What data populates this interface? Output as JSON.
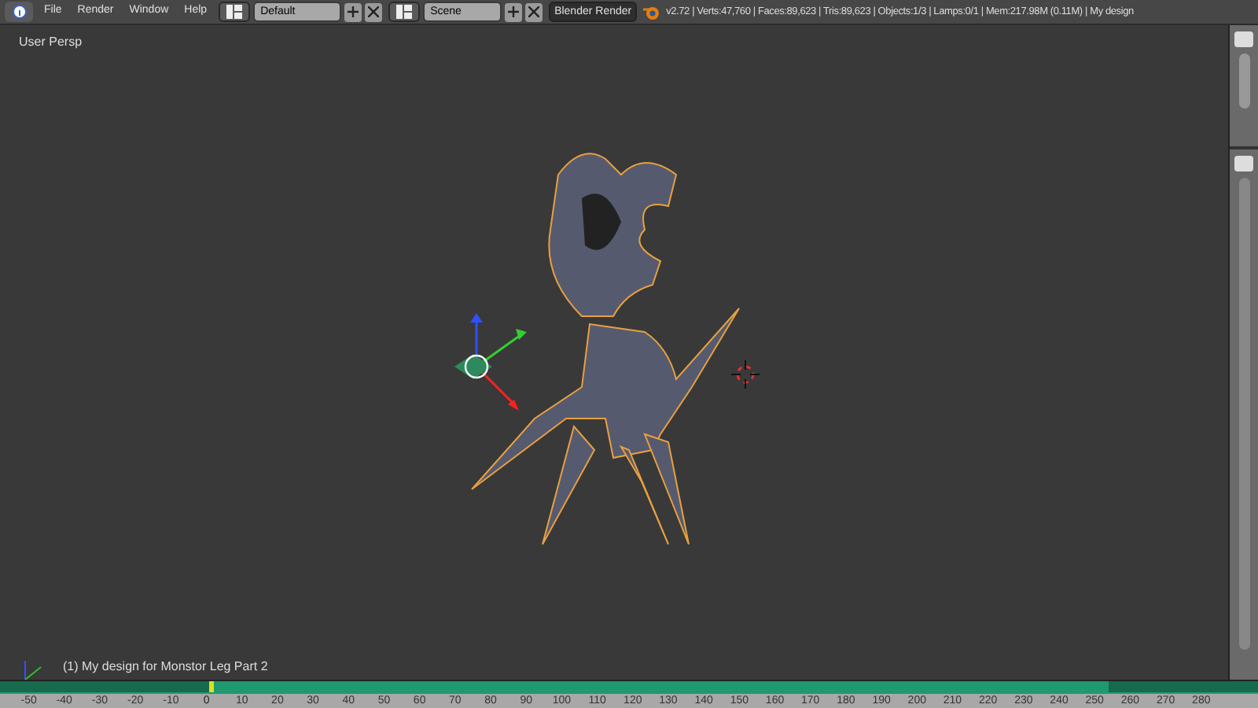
{
  "header": {
    "menus": [
      "File",
      "Render",
      "Window",
      "Help"
    ],
    "layout": "Default",
    "scene": "Scene",
    "engine": "Blender Render",
    "stats": "v2.72 | Verts:47,760 | Faces:89,623 | Tris:89,623 | Objects:1/3 | Lamps:0/1 | Mem:217.98M (0.11M) | My design"
  },
  "viewport": {
    "view_label": "User Persp",
    "object_label": "(1) My design for Monstor Leg Part 2"
  },
  "timeline": {
    "ticks": [
      "-50",
      "-40",
      "-30",
      "-20",
      "-10",
      "0",
      "10",
      "20",
      "30",
      "40",
      "50",
      "60",
      "70",
      "80",
      "90",
      "100",
      "110",
      "120",
      "130",
      "140",
      "150",
      "160",
      "170",
      "180",
      "190",
      "200",
      "210",
      "220",
      "230",
      "240",
      "250",
      "260",
      "270",
      "280"
    ]
  }
}
